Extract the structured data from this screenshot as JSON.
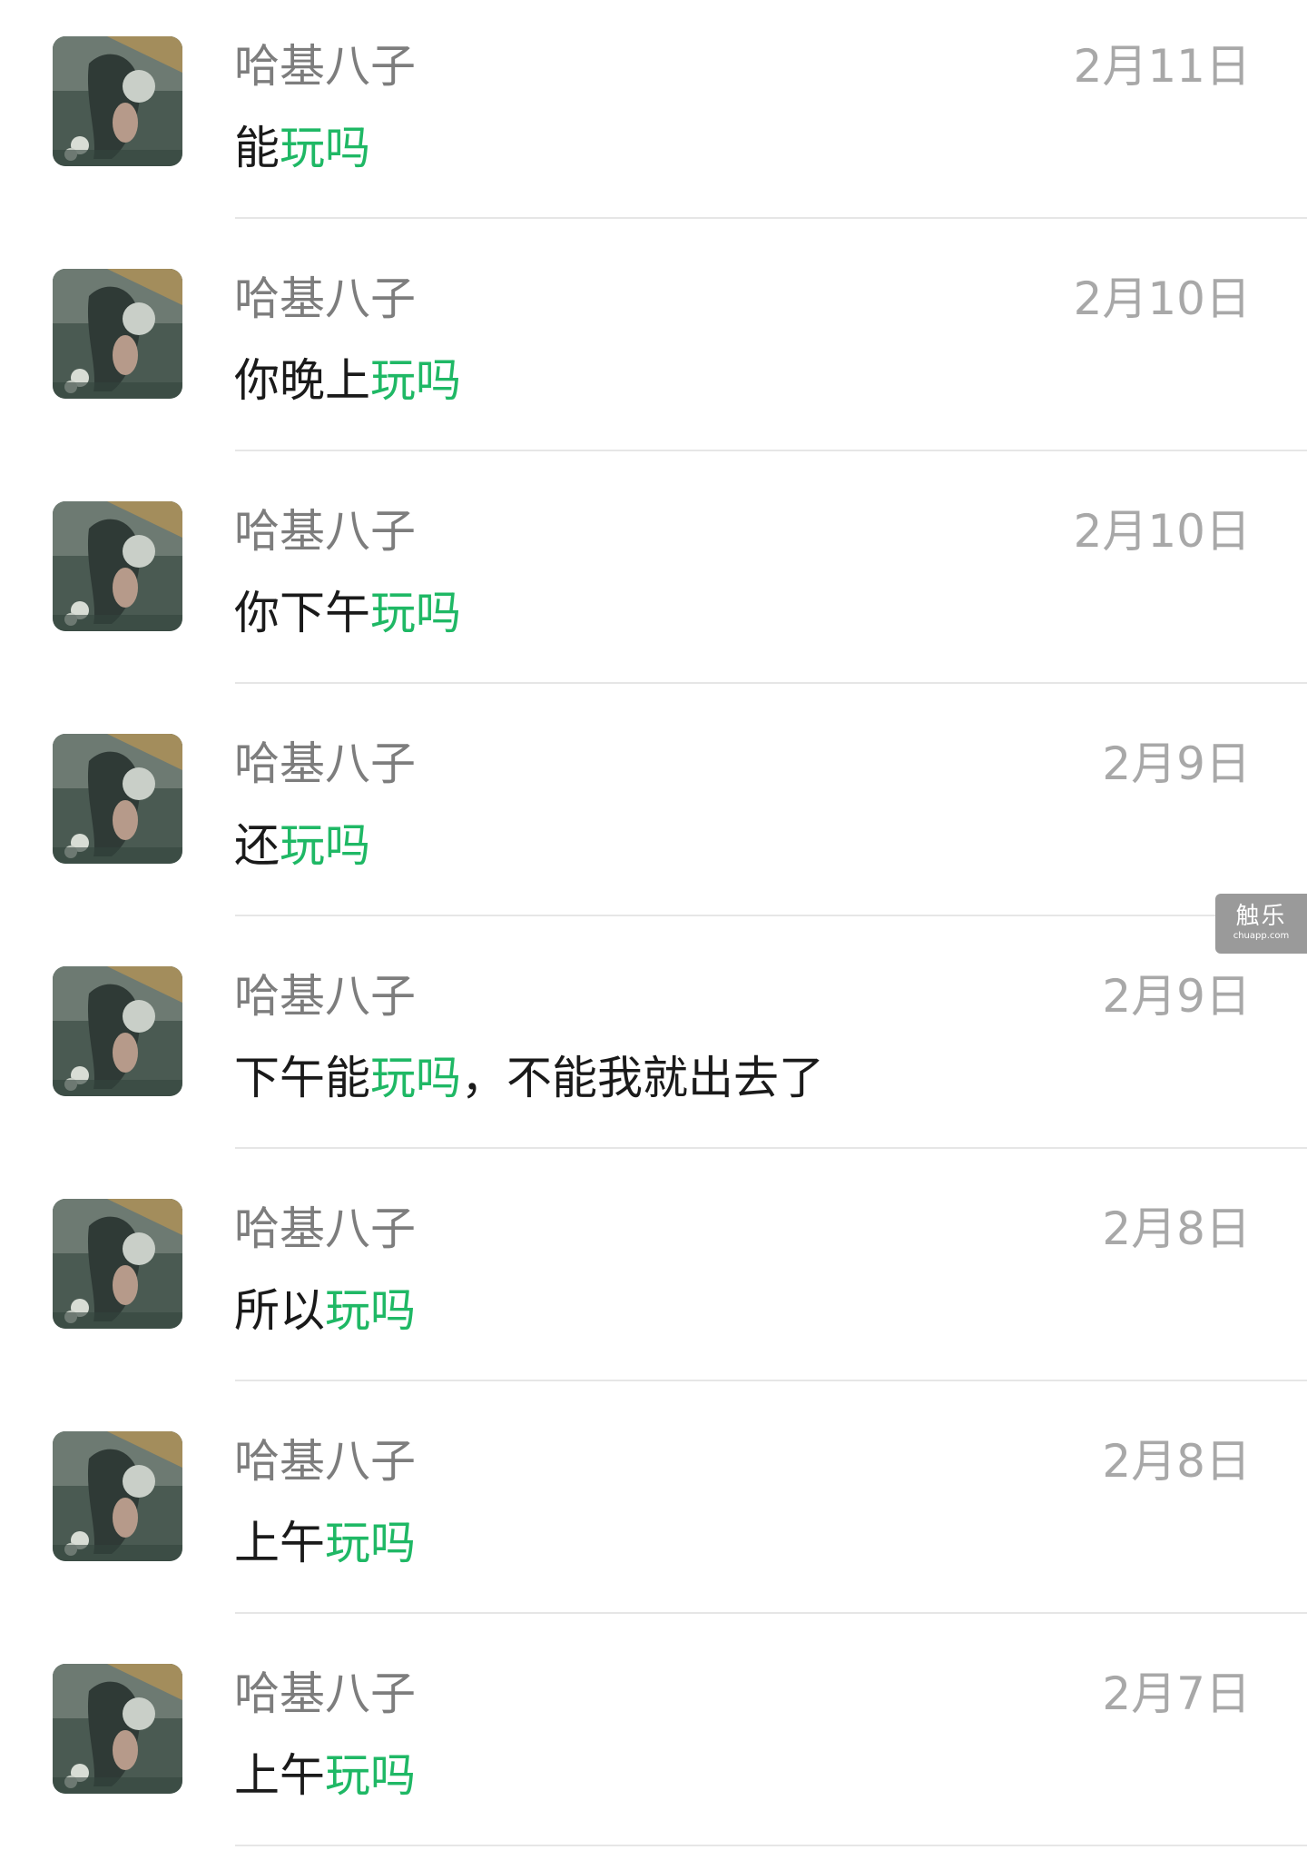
{
  "colors": {
    "name_text": "#7d7d7d",
    "date_text": "#a8a8a8",
    "message_text": "#1a1a1a",
    "highlight": "#1fb865",
    "divider": "#e6e6e6"
  },
  "watermark": {
    "title": "触乐",
    "subtitle": "chuapp.com"
  },
  "messages": [
    {
      "name": "哈基八子",
      "date": "2月11日",
      "text_before": "能",
      "highlight": "玩吗",
      "text_after": ""
    },
    {
      "name": "哈基八子",
      "date": "2月10日",
      "text_before": "你晚上",
      "highlight": "玩吗",
      "text_after": ""
    },
    {
      "name": "哈基八子",
      "date": "2月10日",
      "text_before": "你下午",
      "highlight": "玩吗",
      "text_after": ""
    },
    {
      "name": "哈基八子",
      "date": "2月9日",
      "text_before": "还",
      "highlight": "玩吗",
      "text_after": ""
    },
    {
      "name": "哈基八子",
      "date": "2月9日",
      "text_before": "下午能",
      "highlight": "玩吗",
      "text_after": "，不能我就出去了"
    },
    {
      "name": "哈基八子",
      "date": "2月8日",
      "text_before": "所以",
      "highlight": "玩吗",
      "text_after": ""
    },
    {
      "name": "哈基八子",
      "date": "2月8日",
      "text_before": "上午",
      "highlight": "玩吗",
      "text_after": ""
    },
    {
      "name": "哈基八子",
      "date": "2月7日",
      "text_before": "上午",
      "highlight": "玩吗",
      "text_after": ""
    }
  ]
}
